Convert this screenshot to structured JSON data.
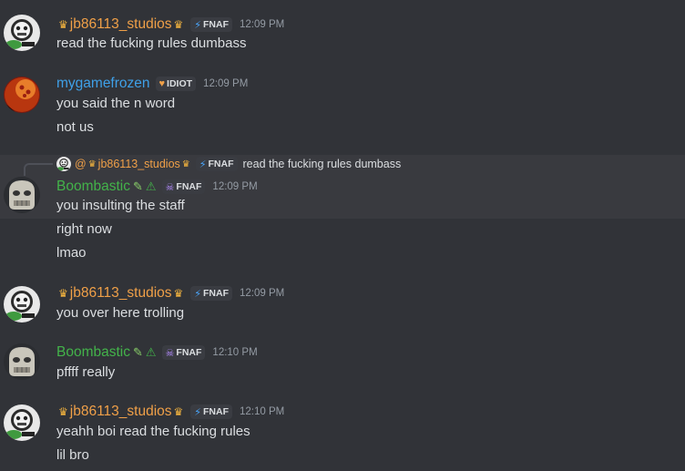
{
  "messages": [
    {
      "author": "jb86113_studios",
      "tag": "FNAF",
      "time": "12:09 PM",
      "lines": [
        "read the fucking rules dumbass"
      ]
    },
    {
      "author": "mygamefrozen",
      "tag": "IDIOT",
      "time": "12:09 PM",
      "lines": [
        "you said the n word",
        "not us"
      ]
    },
    {
      "reply": {
        "at": "@",
        "author": "jb86113_studios",
        "tag": "FNAF",
        "text": "read the fucking rules dumbass"
      },
      "author": "Boombastic",
      "tag": "FNAF",
      "time": "12:09 PM",
      "lines": [
        "you insulting the staff",
        "right now",
        "lmao"
      ]
    },
    {
      "author": "jb86113_studios",
      "tag": "FNAF",
      "time": "12:09 PM",
      "lines": [
        "you over here trolling"
      ]
    },
    {
      "author": "Boombastic",
      "tag": "FNAF",
      "time": "12:10 PM",
      "lines": [
        "pffff really"
      ]
    },
    {
      "author": "jb86113_studios",
      "tag": "FNAF",
      "time": "12:10 PM",
      "lines": [
        "yeahh boi read the fucking rules",
        "lil bro"
      ]
    }
  ],
  "colors": {
    "background": "#313338",
    "highlight": "#393a3f",
    "jb_name": "#f0a048",
    "mygame_name": "#3fa0e8",
    "boombastic_name": "#43b34a",
    "timestamp": "#949ba4",
    "text": "#dbdee1"
  },
  "icons": {
    "crown": "crown-icon",
    "bolt": "lightning-icon",
    "heart": "heart-icon",
    "skull": "skull-icon",
    "syringe": "syringe-icon",
    "warning": "warning-icon"
  }
}
